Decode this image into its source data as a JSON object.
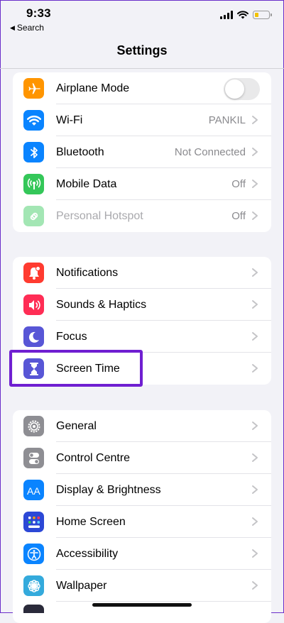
{
  "status_bar": {
    "time": "9:33",
    "back_label": "Search"
  },
  "nav": {
    "title": "Settings"
  },
  "groups": [
    [
      {
        "label": "Airplane Mode",
        "icon": "airplane-icon",
        "color": "#ff9500",
        "control": "toggle",
        "toggle_on": false
      },
      {
        "label": "Wi-Fi",
        "icon": "wifi-icon",
        "color": "#0a84ff",
        "value": "PANKIL"
      },
      {
        "label": "Bluetooth",
        "icon": "bluetooth-icon",
        "color": "#0a84ff",
        "value": "Not Connected"
      },
      {
        "label": "Mobile Data",
        "icon": "antenna-icon",
        "color": "#34c759",
        "value": "Off"
      },
      {
        "label": "Personal Hotspot",
        "icon": "hotspot-icon",
        "color": "#34c759",
        "value": "Off",
        "disabled": true
      }
    ],
    [
      {
        "label": "Notifications",
        "icon": "bell-icon",
        "color": "#ff3b30"
      },
      {
        "label": "Sounds & Haptics",
        "icon": "speaker-icon",
        "color": "#ff2d55"
      },
      {
        "label": "Focus",
        "icon": "moon-icon",
        "color": "#5856d6"
      },
      {
        "label": "Screen Time",
        "icon": "hourglass-icon",
        "color": "#5856d6",
        "highlighted": true
      }
    ],
    [
      {
        "label": "General",
        "icon": "gear-icon",
        "color": "#8e8e93"
      },
      {
        "label": "Control Centre",
        "icon": "switches-icon",
        "color": "#8e8e93"
      },
      {
        "label": "Display & Brightness",
        "icon": "text-size-icon",
        "color": "#0a84ff"
      },
      {
        "label": "Home Screen",
        "icon": "app-grid-icon",
        "color": "#2c48d6"
      },
      {
        "label": "Accessibility",
        "icon": "accessibility-icon",
        "color": "#0a84ff"
      },
      {
        "label": "Wallpaper",
        "icon": "flower-icon",
        "color": "#34aadc"
      }
    ]
  ],
  "colors": {
    "highlight": "#6f1fd1",
    "background": "#f2f2f7"
  }
}
